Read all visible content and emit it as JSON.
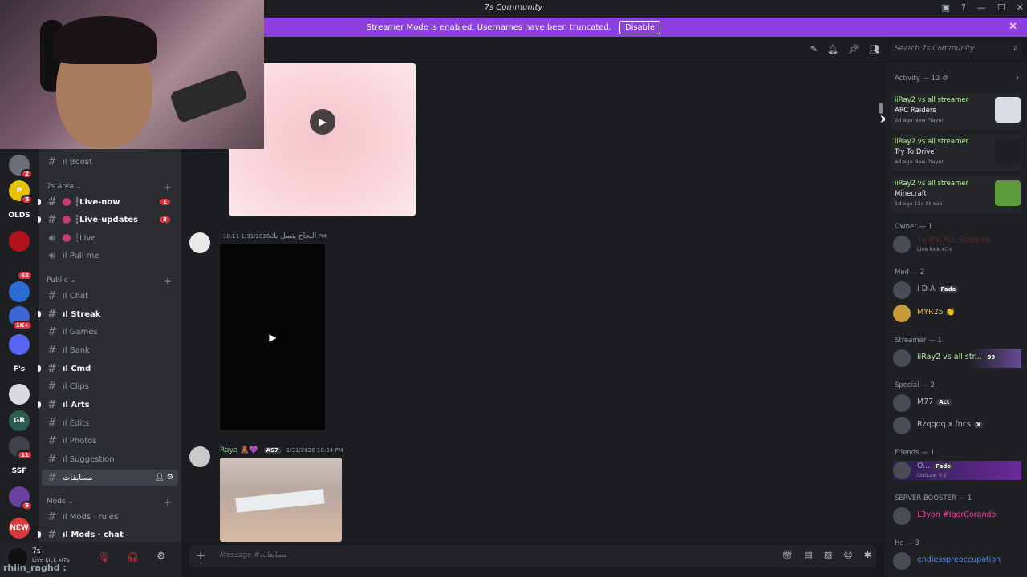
{
  "window": {
    "title": "7s Community"
  },
  "banner": {
    "text": "Streamer Mode is enabled. Usernames have been truncated.",
    "disable_label": "Disable"
  },
  "search": {
    "placeholder": "Search 7s Community"
  },
  "guilds": [
    {
      "label": "",
      "badge": "2",
      "color": "#6a6f78"
    },
    {
      "label": "P",
      "badge": "8",
      "color": "#e7c200"
    },
    {
      "label": "OLDS",
      "badge": "",
      "color": "#1e1f22"
    },
    {
      "label": "",
      "badge": "",
      "color": "#b3121b"
    },
    {
      "label": "",
      "badge": "62",
      "color": "#1e1f22"
    },
    {
      "label": "",
      "badge": "",
      "color": "#2d6bd4"
    },
    {
      "label": "",
      "badge": "1K+",
      "color": "#3a66d6"
    },
    {
      "label": "",
      "badge": "",
      "color": "#5865f2"
    },
    {
      "label": "F's",
      "badge": "",
      "color": "#1e1f22"
    },
    {
      "label": "",
      "badge": "",
      "color": "#d9dbe0"
    },
    {
      "label": "GR",
      "badge": "",
      "color": "#2b5c4e"
    },
    {
      "label": "",
      "badge": "11",
      "color": "#41434a"
    },
    {
      "label": "SSF",
      "badge": "",
      "color": "#1e1f22"
    },
    {
      "label": "",
      "badge": "9",
      "color": "#6b3fa0"
    },
    {
      "label": "NEW",
      "badge": "",
      "color": "#da373c"
    }
  ],
  "channels": {
    "cat_7s_area": "7s Area",
    "cat_public": "Public",
    "cat_mods": "Mods",
    "boost": "ıl Boost",
    "live_now": "┆Live-now",
    "live_now_count": "1",
    "live_updates": "┆Live-updates",
    "live_updates_count": "3",
    "live": "┆Live",
    "pull_me": "ıl Pull me",
    "chat": "ıl Chat",
    "streak": "ıl Streak",
    "games": "ıl Games",
    "bank": "ıl Bank",
    "cmd": "ıl Cmd",
    "clips": "ıl Clips",
    "arts": "ıl Arts",
    "edits": "ıl Edits",
    "photos": "ıl Photos",
    "suggestion": "ıl Suggestion",
    "active": "مسابقات",
    "mods_rules": "ıl Mods · rules",
    "mods_chat": "ıl Mods · chat"
  },
  "user_panel": {
    "name": "7s",
    "status": "Live kick xi7s",
    "overlay_text": "rhiin_raghd :"
  },
  "messages": [
    {
      "author": "النجاح يتصل بك",
      "time": "1/31/2026 10:11 PM"
    },
    {
      "author": "Raya 🧸💜",
      "tag": "AS7",
      "time": "1/31/2026 10:34 PM"
    }
  ],
  "composer": {
    "placeholder": "Message #مسابقات"
  },
  "activity": {
    "header": "Activity — 12",
    "items": [
      {
        "who": "iiRay2 vs all streamer",
        "game": "ARC Raiders",
        "meta": "2d ago  New Player",
        "thumb_color": "#d8dde4"
      },
      {
        "who": "iiRay2 vs all streamer",
        "game": "Try To Drive",
        "meta": "4d ago  New Player",
        "thumb_color": "#1f2023"
      },
      {
        "who": "iiRay2 vs all streamer",
        "game": "Minecraft",
        "meta": "1d ago  15x Streak",
        "thumb_color": "#5c9b3a"
      }
    ]
  },
  "members": {
    "owner_header": "Owner — 1",
    "owner_name": "7s 9% ALL Streams",
    "owner_sub": "Live kick xi7s",
    "mod_header": "Mod — 2",
    "mod1": "i D A",
    "mod1_tag": "Fade",
    "mod2": "MYR25 👏",
    "streamer_header": "Streamer — 1",
    "streamer1": "iiRay2 vs all str...",
    "streamer1_tag": "99",
    "special_header": "Special — 2",
    "special1": "M77",
    "special1_tag": "Act",
    "special2": "Rzqqqq x fncs",
    "special2_tag": "X",
    "friends_header": "Friends — 1",
    "friend1": "O...",
    "friend1_tag": "Fade",
    "friend1_sub": "OutLaw V.2",
    "booster_header": "SERVER BOOSTER — 1",
    "booster1": "L3yon #IgorCorando",
    "he_header": "He — 3",
    "he1": "endlesspreoccupation"
  },
  "colors": {
    "accent": "#8e3fe0",
    "green": "#b6ec9d",
    "pink": "#eb459e",
    "streamer_green": "#b6ec9d"
  }
}
